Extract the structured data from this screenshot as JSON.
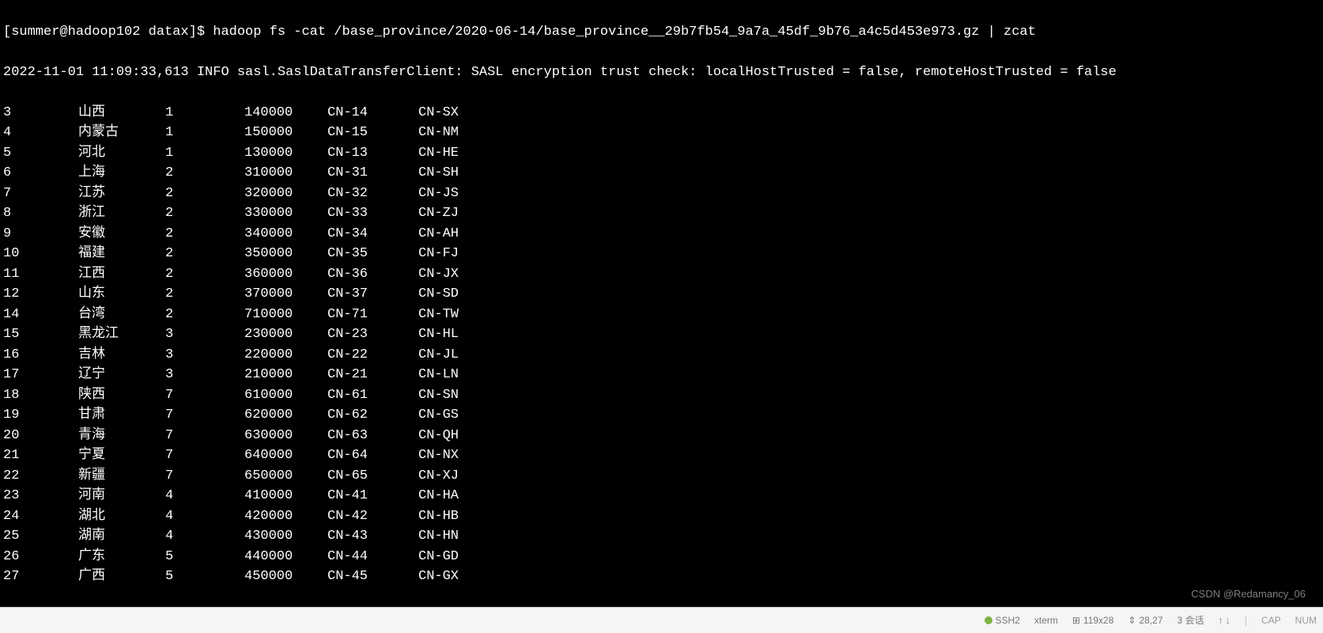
{
  "terminal": {
    "prompt": "[summer@hadoop102 datax]$ ",
    "command": "hadoop fs -cat /base_province/2020-06-14/base_province__29b7fb54_9a7a_45df_9b76_a4c5d453e973.gz | zcat",
    "log_line": "2022-11-01 11:09:33,613 INFO sasl.SaslDataTransferClient: SASL encryption trust check: localHostTrusted = false, remoteHostTrusted = false",
    "rows": [
      {
        "id": "3",
        "name": "山西",
        "region": "1",
        "area": "140000",
        "iso1": "CN-14",
        "iso2": "CN-SX"
      },
      {
        "id": "4",
        "name": "内蒙古",
        "region": "1",
        "area": "150000",
        "iso1": "CN-15",
        "iso2": "CN-NM"
      },
      {
        "id": "5",
        "name": "河北",
        "region": "1",
        "area": "130000",
        "iso1": "CN-13",
        "iso2": "CN-HE"
      },
      {
        "id": "6",
        "name": "上海",
        "region": "2",
        "area": "310000",
        "iso1": "CN-31",
        "iso2": "CN-SH"
      },
      {
        "id": "7",
        "name": "江苏",
        "region": "2",
        "area": "320000",
        "iso1": "CN-32",
        "iso2": "CN-JS"
      },
      {
        "id": "8",
        "name": "浙江",
        "region": "2",
        "area": "330000",
        "iso1": "CN-33",
        "iso2": "CN-ZJ"
      },
      {
        "id": "9",
        "name": "安徽",
        "region": "2",
        "area": "340000",
        "iso1": "CN-34",
        "iso2": "CN-AH"
      },
      {
        "id": "10",
        "name": "福建",
        "region": "2",
        "area": "350000",
        "iso1": "CN-35",
        "iso2": "CN-FJ"
      },
      {
        "id": "11",
        "name": "江西",
        "region": "2",
        "area": "360000",
        "iso1": "CN-36",
        "iso2": "CN-JX"
      },
      {
        "id": "12",
        "name": "山东",
        "region": "2",
        "area": "370000",
        "iso1": "CN-37",
        "iso2": "CN-SD"
      },
      {
        "id": "14",
        "name": "台湾",
        "region": "2",
        "area": "710000",
        "iso1": "CN-71",
        "iso2": "CN-TW"
      },
      {
        "id": "15",
        "name": "黑龙江",
        "region": "3",
        "area": "230000",
        "iso1": "CN-23",
        "iso2": "CN-HL"
      },
      {
        "id": "16",
        "name": "吉林",
        "region": "3",
        "area": "220000",
        "iso1": "CN-22",
        "iso2": "CN-JL"
      },
      {
        "id": "17",
        "name": "辽宁",
        "region": "3",
        "area": "210000",
        "iso1": "CN-21",
        "iso2": "CN-LN"
      },
      {
        "id": "18",
        "name": "陕西",
        "region": "7",
        "area": "610000",
        "iso1": "CN-61",
        "iso2": "CN-SN"
      },
      {
        "id": "19",
        "name": "甘肃",
        "region": "7",
        "area": "620000",
        "iso1": "CN-62",
        "iso2": "CN-GS"
      },
      {
        "id": "20",
        "name": "青海",
        "region": "7",
        "area": "630000",
        "iso1": "CN-63",
        "iso2": "CN-QH"
      },
      {
        "id": "21",
        "name": "宁夏",
        "region": "7",
        "area": "640000",
        "iso1": "CN-64",
        "iso2": "CN-NX"
      },
      {
        "id": "22",
        "name": "新疆",
        "region": "7",
        "area": "650000",
        "iso1": "CN-65",
        "iso2": "CN-XJ"
      },
      {
        "id": "23",
        "name": "河南",
        "region": "4",
        "area": "410000",
        "iso1": "CN-41",
        "iso2": "CN-HA"
      },
      {
        "id": "24",
        "name": "湖北",
        "region": "4",
        "area": "420000",
        "iso1": "CN-42",
        "iso2": "CN-HB"
      },
      {
        "id": "25",
        "name": "湖南",
        "region": "4",
        "area": "430000",
        "iso1": "CN-43",
        "iso2": "CN-HN"
      },
      {
        "id": "26",
        "name": "广东",
        "region": "5",
        "area": "440000",
        "iso1": "CN-44",
        "iso2": "CN-GD"
      },
      {
        "id": "27",
        "name": "广西",
        "region": "5",
        "area": "450000",
        "iso1": "CN-45",
        "iso2": "CN-GX"
      }
    ]
  },
  "statusbar": {
    "ssh": "SSH2",
    "term": "xterm",
    "size_icon": "⊞",
    "size": "119x28",
    "cursor_icon": "⇕",
    "cursor": "28,27",
    "sessions": "3 会话",
    "arrows": "↑  ↓",
    "cap": "CAP",
    "num": "NUM"
  },
  "watermark": "CSDN @Redamancy_06"
}
